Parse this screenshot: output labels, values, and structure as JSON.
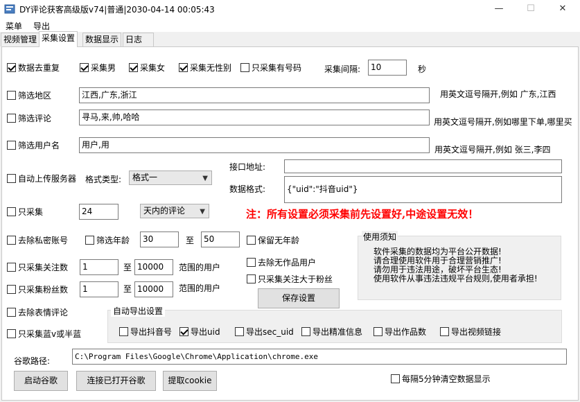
{
  "window": {
    "title": "DY评论获客高级版v74|普通|2030-04-14 00:05:43",
    "minimize_glyph": "—",
    "maximize_glyph": "☐",
    "close_glyph": "✕"
  },
  "menu": [
    "菜单",
    "导出"
  ],
  "tabs": [
    {
      "label": "视频管理",
      "active": false
    },
    {
      "label": "采集设置",
      "active": true
    },
    {
      "label": "数据显示",
      "active": false
    },
    {
      "label": "日志",
      "active": false
    }
  ],
  "row1": {
    "dedup": {
      "label": "数据去重复",
      "checked": true
    },
    "male": {
      "label": "采集男",
      "checked": true
    },
    "female": {
      "label": "采集女",
      "checked": true
    },
    "nogender": {
      "label": "采集无性别",
      "checked": true
    },
    "phone_only": {
      "label": "只采集有号码",
      "checked": false
    },
    "interval_label": "采集间隔:",
    "interval_value": "10",
    "interval_unit": "秒"
  },
  "region": {
    "label": "筛选地区",
    "checked": false,
    "value": "江西,广东,浙江",
    "hint": "用英文逗号隔开,例如 广东,江西"
  },
  "comment": {
    "label": "筛选评论",
    "checked": false,
    "value": "寻马,来,帅,哈哈",
    "hint": "用英文逗号隔开,例如哪里下单,哪里买"
  },
  "username": {
    "label": "筛选用户名",
    "checked": false,
    "value": "用户,用",
    "hint": "用英文逗号隔开,例如  张三,李四"
  },
  "upload": {
    "label": "自动上传服务器",
    "checked": false,
    "format_label": "格式类型:",
    "format_value": "格式一",
    "api_label": "接口地址:",
    "api_value": "",
    "data_format_label": "数据格式:",
    "data_format_value": "{\"uid\":\"抖音uid\"}"
  },
  "only_collect": {
    "label": "只采集",
    "checked": false,
    "days": "24",
    "range_value": "天内的评论"
  },
  "notice": "注：所有设置必须采集前先设置好,中途设置无效！",
  "private": {
    "label": "去除私密账号",
    "checked": false
  },
  "age": {
    "label": "筛选年龄",
    "checked": false,
    "from": "30",
    "to_label": "至",
    "to": "50"
  },
  "keep_no_age": {
    "label": "保留无年龄",
    "checked": false
  },
  "following": {
    "label": "只采集关注数",
    "checked": false,
    "from": "1",
    "to_label": "至",
    "to": "10000",
    "suffix": "范围的用户"
  },
  "followers": {
    "label": "只采集粉丝数",
    "checked": false,
    "from": "1",
    "to_label": "至",
    "to": "10000",
    "suffix": "范围的用户"
  },
  "no_works": {
    "label": "去除无作品用户",
    "checked": false
  },
  "follow_gt_fans": {
    "label": "只采集关注大于粉丝",
    "checked": false
  },
  "save_button": "保存设置",
  "usage": {
    "title": "使用须知",
    "lines": [
      "软件采集的数据均为平台公开数据!",
      "请合理使用软件用于合理营销推广!",
      "请勿用于违法用途，破坏平台生态!",
      "使用软件从事违法违规平台规则,使用者承担!"
    ]
  },
  "emoji": {
    "label": "去除表情评论",
    "checked": false
  },
  "blue_v": {
    "label": "只采集蓝v或半蓝",
    "checked": false
  },
  "export": {
    "title": "自动导出设置",
    "options": [
      {
        "label": "导出抖音号",
        "checked": false
      },
      {
        "label": "导出uid",
        "checked": true
      },
      {
        "label": "导出sec_uid",
        "checked": false
      },
      {
        "label": "导出精准信息",
        "checked": false
      },
      {
        "label": "导出作品数",
        "checked": false
      },
      {
        "label": "导出视频链接",
        "checked": false
      }
    ]
  },
  "chrome": {
    "label": "谷歌路径:",
    "value": "C:\\Program Files\\Google\\Chrome\\Application\\chrome.exe"
  },
  "buttons": {
    "start_chrome": "启动谷歌",
    "connect_chrome": "连接已打开谷歌",
    "get_cookie": "提取cookie"
  },
  "clear_every5": {
    "label": "每隔5分钟清空数据显示",
    "checked": false
  },
  "colors": {
    "notice": "#ff0000"
  }
}
